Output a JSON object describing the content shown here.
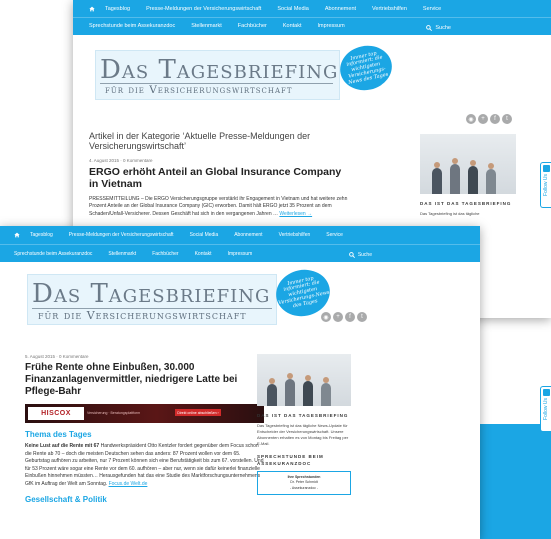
{
  "nav": {
    "items": [
      "Tagesblog",
      "Presse-Meldungen der Versicherungswirtschaft",
      "Social Media",
      "Abonnement",
      "Vertriebshilfen",
      "Service"
    ],
    "items2": [
      "Sprechstunde beim Assekuranzdoc",
      "Stellenmarkt",
      "Fachbücher",
      "Kontakt",
      "Impressum"
    ],
    "search_label": "Suche"
  },
  "logo": {
    "main": "Das Tagesbriefing",
    "sub": "für die Versicherungswirtschaft"
  },
  "badge": {
    "text": "Immer top informiert: die wichtigsten Versicherungs-News des Tages"
  },
  "social_icons": [
    "rss-icon",
    "google-plus-icon",
    "facebook-icon",
    "twitter-icon"
  ],
  "window1": {
    "category_heading": "Artikel in der Kategorie ‘Aktuelle Presse-Meldungen der Versicherungswirtschaft’",
    "post_meta": "4. August 2015 · 0 Kommentare",
    "post_title": "ERGO erhöht Anteil an Global Insurance Company in Vietnam",
    "body": "PRESSEMITTEILUNG – Die ERGO Versicherungsgruppe verstärkt ihr Engagement in Vietnam und hat weitere zehn Prozent Anteile an der Global Insurance Company (GIC) erworben. Damit hält ERGO jetzt 35 Prozent an dem Schaden/Unfall-Versicherer. Dessen Geschäft hat sich in den vergangenen Jahren …",
    "read_more": "Weiterlesen →",
    "sidebar_title": "DAS IST DAS TAGESBRIEFING",
    "sidebar_text": "Das Tagesbriefing ist das tägliche"
  },
  "window2": {
    "post_meta": "5. August 2015 · 0 Kommentare",
    "post_title": "Frühe Rente ohne Einbußen, 30.000 Finanzanlagenvermittler, niedrigere Latte bei Pflege-Bahr",
    "ad_logo": "HISCOX",
    "ad_sub": "Versicherung · Beratungsplattform",
    "ad_cta": "Direkt online abschließen ›",
    "section1": "Thema des Tages",
    "body_lead": "Keine Lust auf die Rente mit 67",
    "body": " Handwerkspräsident Otto Kentzler fordert gegenüber dem Focus schon die Rente ab 70 – doch die meisten Deutschen sehen das anders: 87 Prozent wollen vor dem 65. Geburtstag aufhören zu arbeiten, nur 7 Prozent können sich eine Berufstätigkeit bis zum 67. vorstellen. Und für 53 Prozent wäre sogar eine Rente vor dem 60. aufhören – aber nur, wenn sie dafür keinerlei finanzielle Einbußen hinnehmen müssten… Herausgefunden hat das eine Studie des Marktforschungsunternehmens GfK im Auftrag der Welt am Sonntag.",
    "body_link": "Focus.de Welt.de",
    "section2": "Gesellschaft & Politik",
    "sidebar_title": "DAS IST DAS TAGESBRIEFING",
    "sidebar_text": "Das Tagesbriefing ist das tägliche News-Update für Entscheider der Versicherungswirtschaft. Unsere Abonnenten erhalten es von Montag bis Freitag per E-Mail.",
    "sidebar_title2": "SPRECHSTUNDE BEIM ASSEKURANZDOC",
    "box_title": "Ihre Sprechstunden",
    "box_name": "Dr. Peter Schmidt",
    "box_role": "- Assekuranzdoc -"
  },
  "follow_label": "Follow Us",
  "colors": {
    "accent": "#1ba6e4"
  }
}
